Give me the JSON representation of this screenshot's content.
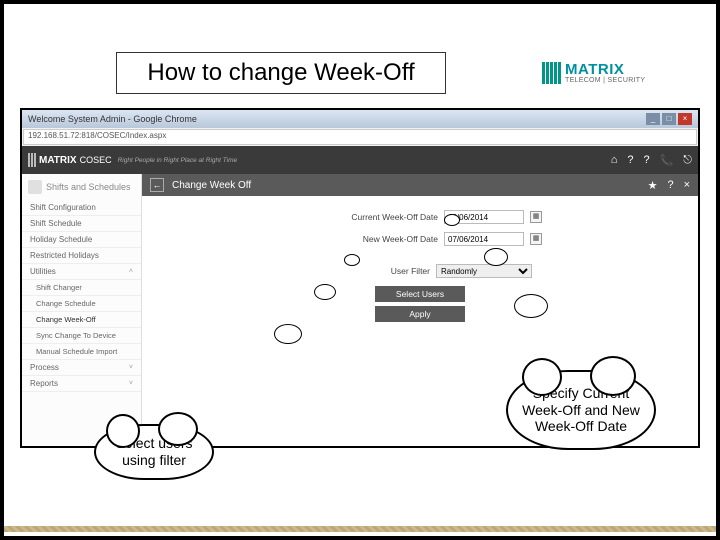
{
  "slide_title": "How to change Week-Off",
  "brand": {
    "name": "MATRIX",
    "subtitle": "TELECOM | SECURITY"
  },
  "browser": {
    "window_title": "Welcome System Admin - Google Chrome",
    "url": "192.168.51.72:818/COSEC/Index.aspx"
  },
  "app_header": {
    "logo_name": "MATRIX",
    "product": "COSEC",
    "tagline": "Right People in Right Place at Right Time",
    "icons": [
      "⌂",
      "?",
      "?",
      "📞",
      "⎋"
    ]
  },
  "sidebar": {
    "group": "Shifts and Schedules",
    "items": [
      "Shift Configuration",
      "Shift Schedule",
      "Holiday Schedule",
      "Restricted Holidays"
    ],
    "utilities_label": "Utilities",
    "utilities": [
      "Shift Changer",
      "Change Schedule",
      "Change Week-Off",
      "Sync Change To Device",
      "Manual Schedule Import"
    ],
    "process_label": "Process",
    "reports_label": "Reports"
  },
  "page": {
    "title": "Change Week Off",
    "current_label": "Current Week-Off Date",
    "current_value": "06/06/2014",
    "new_label": "New Week-Off Date",
    "new_value": "07/06/2014",
    "filter_label": "User Filter",
    "filter_value": "Randomly",
    "select_btn": "Select Users",
    "apply_btn": "Apply"
  },
  "clouds": {
    "c1": "Select users using filter",
    "c2": "Specify Current Week-Off and New Week-Off Date"
  }
}
